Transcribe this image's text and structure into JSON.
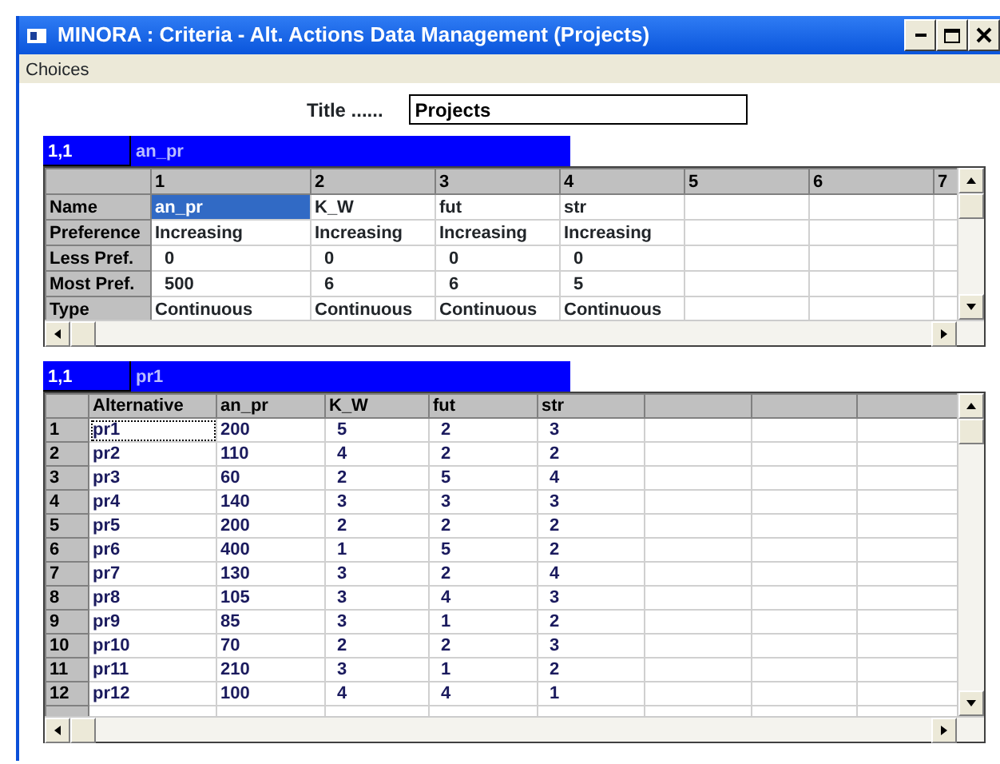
{
  "window": {
    "title": "MINORA : Criteria - Alt. Actions Data Management (Projects)"
  },
  "menu": [
    "Choices"
  ],
  "title_field": {
    "label": "Title ......",
    "value": "Projects"
  },
  "criteria_grid": {
    "cell_ref": "1,1",
    "cell_value": "an_pr",
    "columns": [
      "1",
      "2",
      "3",
      "4",
      "5",
      "6",
      "7"
    ],
    "rows": [
      {
        "label": "Name",
        "cells": [
          {
            "text": "an_pr",
            "selected": true
          },
          {
            "text": "K_W",
            "selected": false
          },
          {
            "text": "fut",
            "selected": false
          },
          {
            "text": "str",
            "selected": false
          }
        ]
      },
      {
        "label": "Preference",
        "cells": [
          {
            "text": "Increasing",
            "selected": false
          },
          {
            "text": "Increasing",
            "selected": false
          },
          {
            "text": "Increasing",
            "selected": false
          },
          {
            "text": "Increasing",
            "selected": false
          }
        ]
      },
      {
        "label": "Less Pref.",
        "cells": [
          {
            "text": "0",
            "selected": false
          },
          {
            "text": "0",
            "selected": false
          },
          {
            "text": "0",
            "selected": false
          },
          {
            "text": "0",
            "selected": false
          }
        ]
      },
      {
        "label": "Most Pref.",
        "cells": [
          {
            "text": "500",
            "selected": false
          },
          {
            "text": "6",
            "selected": false
          },
          {
            "text": "6",
            "selected": false
          },
          {
            "text": "5",
            "selected": false
          }
        ]
      },
      {
        "label": "Type",
        "cells": [
          {
            "text": "Continuous",
            "selected": false
          },
          {
            "text": "Continuous",
            "selected": false
          },
          {
            "text": "Continuous",
            "selected": false
          },
          {
            "text": "Continuous",
            "selected": false
          }
        ]
      }
    ]
  },
  "alternatives_grid": {
    "cell_ref": "1,1",
    "cell_value": "pr1",
    "columns": [
      "Alternative",
      "an_pr",
      "K_W",
      "fut",
      "str"
    ],
    "rows": [
      {
        "number": "1",
        "cells": [
          "pr1",
          "200",
          "5",
          "2",
          "3"
        ],
        "selected": true
      },
      {
        "number": "2",
        "cells": [
          "pr2",
          "110",
          "4",
          "2",
          "2"
        ],
        "selected": false
      },
      {
        "number": "3",
        "cells": [
          "pr3",
          "60",
          "2",
          "5",
          "4"
        ],
        "selected": false
      },
      {
        "number": "4",
        "cells": [
          "pr4",
          "140",
          "3",
          "3",
          "3"
        ],
        "selected": false
      },
      {
        "number": "5",
        "cells": [
          "pr5",
          "200",
          "2",
          "2",
          "2"
        ],
        "selected": false
      },
      {
        "number": "6",
        "cells": [
          "pr6",
          "400",
          "1",
          "5",
          "2"
        ],
        "selected": false
      },
      {
        "number": "7",
        "cells": [
          "pr7",
          "130",
          "3",
          "2",
          "4"
        ],
        "selected": false
      },
      {
        "number": "8",
        "cells": [
          "pr8",
          "105",
          "3",
          "4",
          "3"
        ],
        "selected": false
      },
      {
        "number": "9",
        "cells": [
          "pr9",
          "85",
          "3",
          "1",
          "2"
        ],
        "selected": false
      },
      {
        "number": "10",
        "cells": [
          "pr10",
          "70",
          "2",
          "2",
          "3"
        ],
        "selected": false
      },
      {
        "number": "11",
        "cells": [
          "pr11",
          "210",
          "3",
          "1",
          "2"
        ],
        "selected": false
      },
      {
        "number": "12",
        "cells": [
          "pr12",
          "100",
          "4",
          "4",
          "1"
        ],
        "selected": false
      }
    ]
  }
}
